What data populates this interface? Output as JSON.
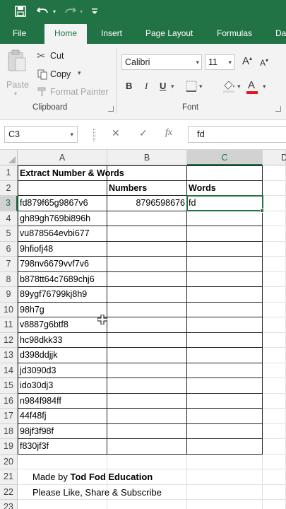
{
  "qat": {
    "save_icon": "save-icon",
    "undo_icon": "undo-icon",
    "redo_icon": "redo-icon",
    "customize_icon": "customize-qat-icon"
  },
  "tabs": [
    {
      "label": "File"
    },
    {
      "label": "Home"
    },
    {
      "label": "Insert"
    },
    {
      "label": "Page Layout"
    },
    {
      "label": "Formulas"
    },
    {
      "label": "Da"
    }
  ],
  "ribbon": {
    "clipboard": {
      "paste_label": "Paste",
      "cut_label": "Cut",
      "copy_label": "Copy",
      "format_painter_label": "Format Painter",
      "group_label": "Clipboard"
    },
    "font": {
      "font_name": "Calibri",
      "font_size": "11",
      "bold": "B",
      "italic": "I",
      "underline": "U",
      "grow": "A",
      "shrink": "A",
      "font_color_letter": "A",
      "group_label": "Font"
    },
    "accent_color": "#217346",
    "font_color": "#e81123"
  },
  "formula_bar": {
    "name_box": "C3",
    "cancel": "✕",
    "enter": "✓",
    "fx": "fx",
    "content": "fd"
  },
  "grid": {
    "columns": [
      "A",
      "B",
      "C",
      "D"
    ],
    "selected_column": "C",
    "selected_row": "3",
    "rows": [
      {
        "num": "1",
        "A": "Extract Number & Words",
        "B": "",
        "C": ""
      },
      {
        "num": "2",
        "A": "",
        "B": "Numbers",
        "C": "Words"
      },
      {
        "num": "3",
        "A": "fd879f65g9867v6",
        "B": "8796598676",
        "C": "fd"
      },
      {
        "num": "4",
        "A": "gh89gh769bi896h",
        "B": "",
        "C": ""
      },
      {
        "num": "5",
        "A": "vu878564evbi677",
        "B": "",
        "C": ""
      },
      {
        "num": "6",
        "A": "9hfiofj48",
        "B": "",
        "C": ""
      },
      {
        "num": "7",
        "A": "798nv6679vvf7v6",
        "B": "",
        "C": ""
      },
      {
        "num": "8",
        "A": "b878tt64c7689chj6",
        "B": "",
        "C": ""
      },
      {
        "num": "9",
        "A": "89ygf76799kj8h9",
        "B": "",
        "C": ""
      },
      {
        "num": "10",
        "A": "98h7g",
        "B": "",
        "C": ""
      },
      {
        "num": "11",
        "A": "v8887g6btf8",
        "B": "",
        "C": ""
      },
      {
        "num": "12",
        "A": "hc98dkk33",
        "B": "",
        "C": ""
      },
      {
        "num": "13",
        "A": "d398ddjjk",
        "B": "",
        "C": ""
      },
      {
        "num": "14",
        "A": "jd3090d3",
        "B": "",
        "C": ""
      },
      {
        "num": "15",
        "A": "ido30dj3",
        "B": "",
        "C": ""
      },
      {
        "num": "16",
        "A": "n984f984ff",
        "B": "",
        "C": ""
      },
      {
        "num": "17",
        "A": "44f48fj",
        "B": "",
        "C": ""
      },
      {
        "num": "18",
        "A": "98jf3f98f",
        "B": "",
        "C": ""
      },
      {
        "num": "19",
        "A": "f830jf3f",
        "B": "",
        "C": ""
      },
      {
        "num": "20",
        "A": "",
        "B": "",
        "C": ""
      },
      {
        "num": "21",
        "A": "",
        "B": "",
        "C": ""
      },
      {
        "num": "22",
        "A": "",
        "B": "",
        "C": ""
      },
      {
        "num": "23",
        "A": "",
        "B": "",
        "C": ""
      }
    ],
    "credit": {
      "prefix": "Made by ",
      "brand": "Tod Fod Education",
      "line2": "Please Like, Share & Subscribe"
    }
  }
}
